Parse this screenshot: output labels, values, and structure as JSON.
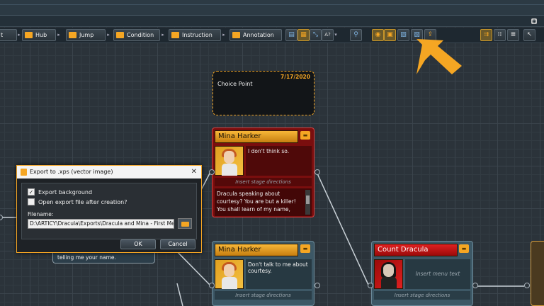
{
  "toolbar": {
    "buttons": [
      {
        "label": "t"
      },
      {
        "label": "Hub"
      },
      {
        "label": "Jump"
      },
      {
        "label": "Condition"
      },
      {
        "label": "Instruction"
      },
      {
        "label": "Annotation"
      }
    ],
    "help_icon_label": "A?"
  },
  "choice_node": {
    "date": "7/17/2020",
    "label": "Choice Point"
  },
  "nodes": [
    {
      "speaker": "Mina Harker",
      "text": "I don't think so.",
      "stage": "Insert stage directions",
      "body": "Dracula speaking about courtesy? You are but a killer! You shall learn of my name,"
    },
    {
      "speaker": "Mina Harker",
      "text": "Don't talk to me about courtesy.",
      "stage": "Insert stage directions"
    },
    {
      "speaker": "Count Dracula",
      "text": "Insert menu text",
      "stage": "Insert stage directions"
    }
  ],
  "background_node": {
    "text": "telling me your name."
  },
  "dialog": {
    "title": "Export to .xps (vector image)",
    "close": "✕",
    "option_background": "Export background",
    "option_background_checked": true,
    "option_open": "Open export file after creation?",
    "option_open_checked": false,
    "filename_label": "Filename:",
    "filename_value": "D:\\ARTICY\\Dracula\\Exports\\Dracula and Mina - First Meeting",
    "ok_label": "OK",
    "cancel_label": "Cancel"
  },
  "colors": {
    "accent": "#f5a623",
    "node_red": "#7a0e0e",
    "node_blue": "#3d5866"
  }
}
